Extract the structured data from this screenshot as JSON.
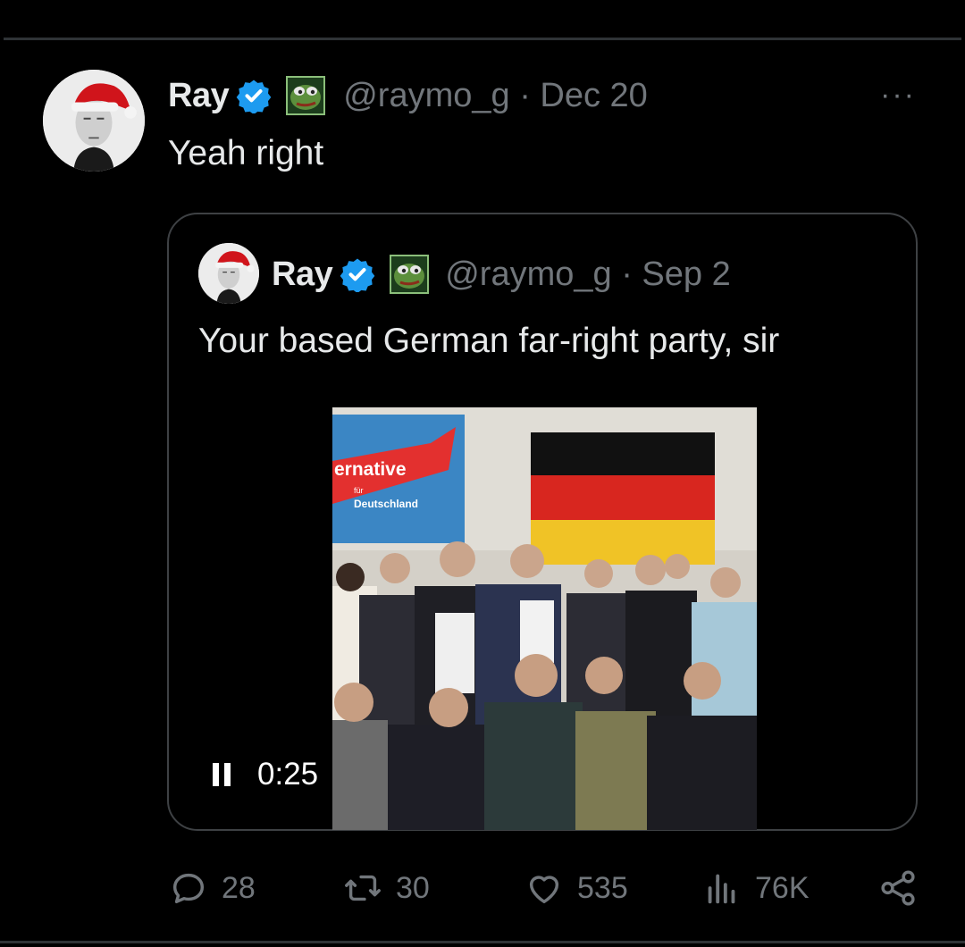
{
  "tweet": {
    "author_name": "Ray",
    "handle_date": "@raymo_g · Dec 20",
    "text": "Yeah right",
    "more_label": "···"
  },
  "quoted_tweet": {
    "author_name": "Ray",
    "handle_date": "@raymo_g · Sep 2",
    "text": "Your based German far-right party, sir",
    "video": {
      "time_label": "0:25",
      "state": "playing",
      "banner_text": "ernative",
      "banner_subtext": "für",
      "banner_subtext2": "Deutschland"
    }
  },
  "actions": {
    "reply_count": "28",
    "retweet_count": "30",
    "like_count": "535",
    "views_count": "76K"
  },
  "icons": [
    "verified-badge-icon",
    "frog-emoji-icon",
    "more-icon",
    "reply-icon",
    "retweet-icon",
    "like-icon",
    "views-icon",
    "share-icon",
    "pause-icon"
  ],
  "colors": {
    "background": "#000000",
    "text": "#e7e9ea",
    "secondary": "#71767b",
    "verified": "#1d9bf0",
    "border": "#3e4144"
  }
}
